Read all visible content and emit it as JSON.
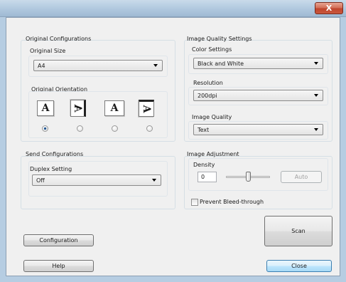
{
  "window": {
    "title": "",
    "close_glyph": "X"
  },
  "original": {
    "group_title": "Original Configurations",
    "size_label": "Original Size",
    "size_value": "A4",
    "orientation_label": "Original Orientation",
    "orientation_glyphs": [
      "A",
      "A",
      "A",
      "A"
    ],
    "selected_orientation": 0
  },
  "send": {
    "group_title": "Send Configurations",
    "duplex_label": "Duplex Setting",
    "duplex_value": "Off"
  },
  "quality": {
    "group_title": "Image Quality Settings",
    "color_label": "Color Settings",
    "color_value": "Black and White",
    "resolution_label": "Resolution",
    "resolution_value": "200dpi",
    "image_quality_label": "Image Quality",
    "image_quality_value": "Text"
  },
  "adjustment": {
    "group_title": "Image Adjustment",
    "density_label": "Density",
    "density_value": "0",
    "auto_label": "Auto",
    "bleed_label": "Prevent Bleed-through",
    "bleed_checked": false
  },
  "buttons": {
    "scan": "Scan",
    "configuration": "Configuration",
    "help": "Help",
    "close": "Close"
  }
}
